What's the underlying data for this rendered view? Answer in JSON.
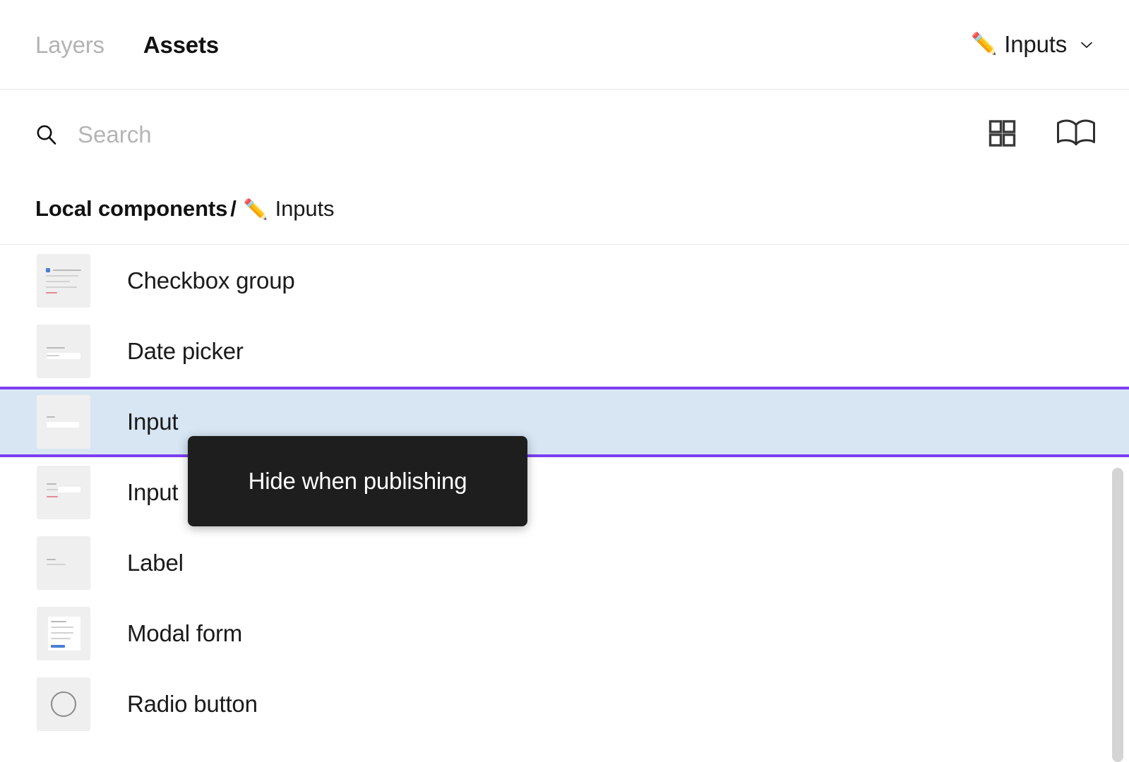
{
  "tabs": [
    {
      "label": "Layers",
      "active": false,
      "name": "tab-layers"
    },
    {
      "label": "Assets",
      "active": true,
      "name": "tab-assets"
    }
  ],
  "page_dropdown": {
    "emoji": "✏️",
    "label": "Inputs",
    "chevron": "chevron-down-icon"
  },
  "search": {
    "placeholder": "Search",
    "value": "",
    "icon": "search-icon"
  },
  "view_toggles": [
    {
      "name": "grid-view-icon",
      "label": "Grid view"
    },
    {
      "name": "book-view-icon",
      "label": "Book view"
    }
  ],
  "breadcrumb": {
    "root": "Local components",
    "separator": "/",
    "emoji": "✏️",
    "current": "Inputs"
  },
  "components": [
    {
      "label": "Checkbox group",
      "thumb": "checkbox-group-thumb",
      "selected": false
    },
    {
      "label": "Date picker",
      "thumb": "date-picker-thumb",
      "selected": false
    },
    {
      "label": "Input",
      "thumb": "input-thumb",
      "selected": true
    },
    {
      "label": "Input",
      "thumb": "input-group-thumb",
      "selected": false
    },
    {
      "label": "Label",
      "thumb": "label-thumb",
      "selected": false
    },
    {
      "label": "Modal form",
      "thumb": "modal-form-thumb",
      "selected": false
    },
    {
      "label": "Radio button",
      "thumb": "radio-button-thumb",
      "selected": false
    }
  ],
  "tooltip": {
    "text": "Hide when publishing"
  },
  "colors": {
    "selection_fill": "#d8e6f4",
    "selection_border": "#7b3ff2",
    "tooltip_bg": "#1e1e1e",
    "tooltip_text": "#ffffff",
    "active_tab_text": "#111111",
    "inactive_tab_text": "#b3b3b3",
    "placeholder_text": "#b5b5b5",
    "divider": "#e6e6e6",
    "thumb_bg": "#efefef",
    "scrollbar": "#d4d4d4"
  }
}
